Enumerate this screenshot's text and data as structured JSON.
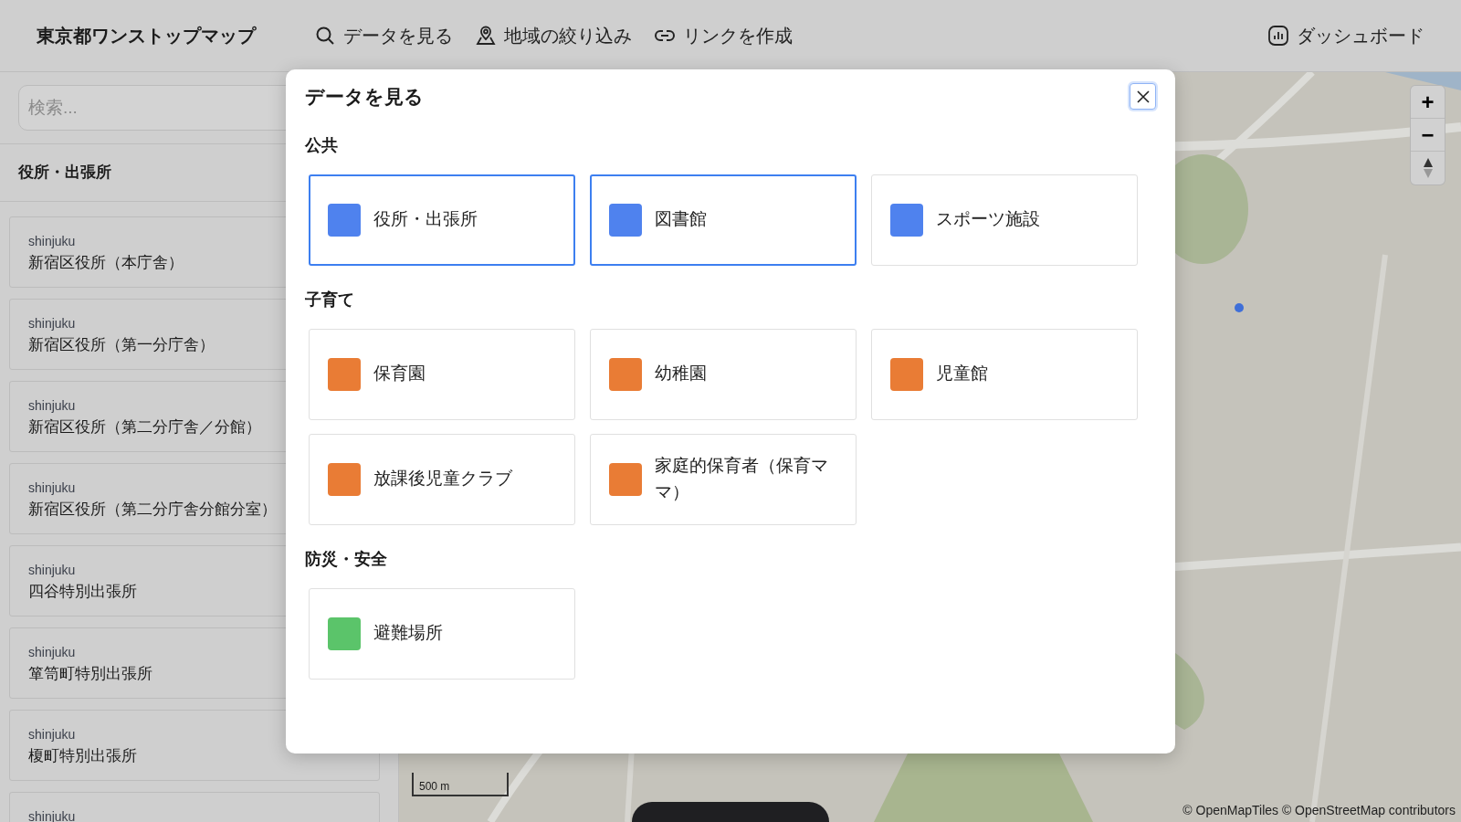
{
  "header": {
    "title": "東京都ワンストップマップ",
    "nav": [
      {
        "kind": "search",
        "label": "データを見る"
      },
      {
        "kind": "pin",
        "label": "地域の絞り込み"
      },
      {
        "kind": "link",
        "label": "リンクを作成"
      }
    ],
    "dashboard": {
      "label": "ダッシュボード"
    }
  },
  "sidebar": {
    "search": {
      "placeholder": "検索..."
    },
    "heading": "役所・出張所",
    "items": [
      {
        "area": "shinjuku",
        "name": "新宿区役所（本庁舎）"
      },
      {
        "area": "shinjuku",
        "name": "新宿区役所（第一分庁舎）"
      },
      {
        "area": "shinjuku",
        "name": "新宿区役所（第二分庁舎／分館）"
      },
      {
        "area": "shinjuku",
        "name": "新宿区役所（第二分庁舎分館分室）"
      },
      {
        "area": "shinjuku",
        "name": "四谷特別出張所"
      },
      {
        "area": "shinjuku",
        "name": "箪笥町特別出張所"
      },
      {
        "area": "shinjuku",
        "name": "榎町特別出張所"
      },
      {
        "area": "shinjuku"
      }
    ]
  },
  "modal": {
    "title": "データを見る",
    "sections": [
      {
        "name": "公共",
        "items": [
          {
            "label": "役所・出張所",
            "color": "#4f82ee",
            "selected": true
          },
          {
            "label": "図書館",
            "color": "#4f82ee",
            "selected": true
          },
          {
            "label": "スポーツ施設",
            "color": "#4f82ee",
            "selected": false
          }
        ]
      },
      {
        "name": "子育て",
        "items": [
          {
            "label": "保育園",
            "color": "#e97c35",
            "selected": false
          },
          {
            "label": "幼稚園",
            "color": "#e97c35",
            "selected": false
          },
          {
            "label": "児童館",
            "color": "#e97c35",
            "selected": false
          },
          {
            "label": "放課後児童クラブ",
            "color": "#e97c35",
            "selected": false
          },
          {
            "label": "家庭的保育者（保育ママ）",
            "color": "#e97c35",
            "selected": false
          }
        ]
      },
      {
        "name": "防災・安全",
        "items": [
          {
            "label": "避難場所",
            "color": "#5bc46a",
            "selected": false
          }
        ]
      }
    ]
  },
  "map": {
    "controls": [
      "+",
      "−"
    ],
    "scale": "500 m",
    "attribution": "© OpenMapTiles © OpenStreetMap contributors"
  }
}
